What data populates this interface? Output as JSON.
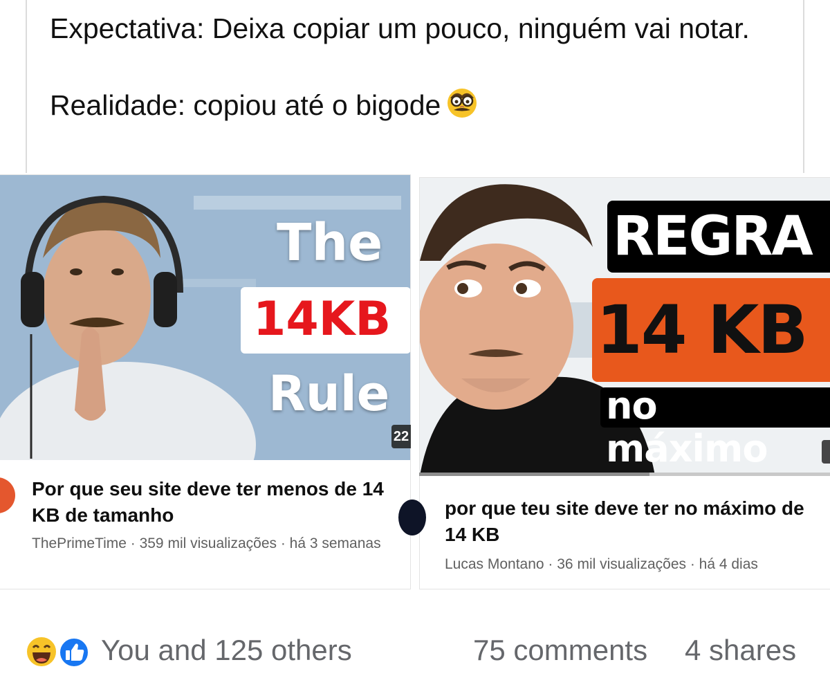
{
  "post": {
    "line1": "Expectativa: Deixa copiar um pouco, ninguém vai notar.",
    "line2": "Realidade: copiou até o bigode",
    "emoji": "disguised-face-emoji"
  },
  "videos": [
    {
      "thumbnail_words": [
        "The",
        "14KB",
        "Rule"
      ],
      "duration": "22",
      "title": "Por que seu site deve ter menos de 14 KB de tamanho",
      "meta": "ThePrimeTime · 359 mil visualizações · há 3 semanas"
    },
    {
      "thumbnail_words": [
        "REGRA",
        "14 KB",
        "no máximo"
      ],
      "title": "por que teu site deve ter no máximo de 14 KB",
      "meta": "Lucas Montano · 36 mil visualizações · há 4 dias",
      "progress": 0.56
    }
  ],
  "footer": {
    "reactions": "You and 125 others",
    "comments": "75 comments",
    "shares": "4 shares",
    "reaction_icons": [
      "haha-icon",
      "like-icon"
    ]
  },
  "colors": {
    "like_blue": "#1877f2",
    "thumb_red": "#e6171d",
    "thumb_orange": "#e8581c",
    "meta_gray": "#606060"
  }
}
